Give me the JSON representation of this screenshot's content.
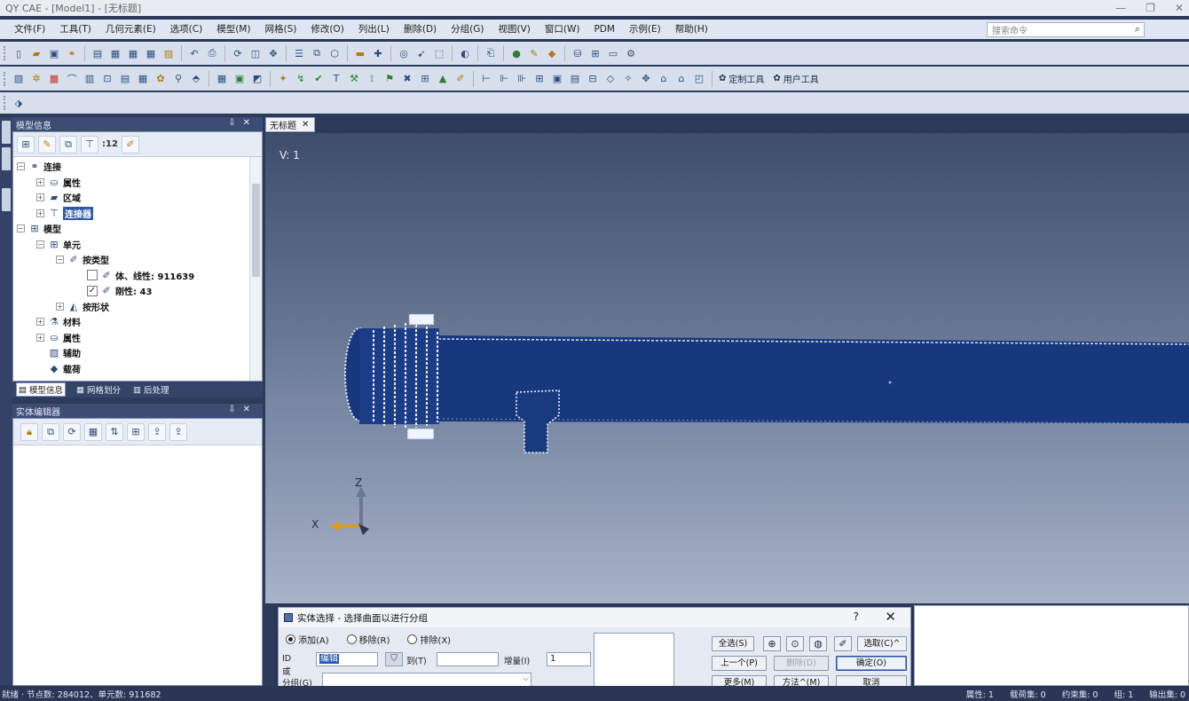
{
  "window": {
    "title": "QY CAE - [Model1] - [无标题]",
    "controls": [
      "—",
      "❐",
      "✕"
    ]
  },
  "menu": [
    "文件(F)",
    "工具(T)",
    "几何元素(E)",
    "选项(C)",
    "模型(M)",
    "网格(S)",
    "修改(O)",
    "列出(L)",
    "删除(D)",
    "分组(G)",
    "视图(V)",
    "窗口(W)",
    "PDM",
    "示例(E)",
    "帮助(H)"
  ],
  "search": {
    "placeholder": "搜索命令",
    "icon": "search-icon"
  },
  "toolbar": {
    "custom_tools": "定制工具",
    "user_tools": "用户工具"
  },
  "model_panel": {
    "title": "模型信息",
    "count_label": ":12",
    "tree": [
      {
        "label": "连接",
        "level": 0,
        "expander": "⊟",
        "icon": "link-icon"
      },
      {
        "label": "属性",
        "level": 1,
        "expander": "⊞",
        "icon": "property-icon"
      },
      {
        "label": "区域",
        "level": 1,
        "expander": "⊞",
        "icon": "region-icon"
      },
      {
        "label": "连接器",
        "level": 1,
        "expander": "⊞",
        "icon": "connector-icon",
        "selected": true
      },
      {
        "label": "模型",
        "level": 0,
        "expander": "⊟",
        "icon": "model-icon"
      },
      {
        "label": "单元",
        "level": 1,
        "expander": "⊟",
        "icon": "element-icon"
      },
      {
        "label": "按类型",
        "level": 2,
        "expander": "⊟",
        "icon": "type-icon"
      },
      {
        "label": "体、线性: 911639",
        "level": 3,
        "checkbox": false,
        "icon": "solid-icon"
      },
      {
        "label": "刚性: 43",
        "level": 3,
        "checkbox": true,
        "icon": "rigid-icon"
      },
      {
        "label": "按形状",
        "level": 2,
        "expander": "⊞",
        "icon": "shape-icon"
      },
      {
        "label": "材料",
        "level": 1,
        "expander": "⊞",
        "icon": "material-icon"
      },
      {
        "label": "属性",
        "level": 1,
        "expander": "⊞",
        "icon": "property-icon"
      },
      {
        "label": "辅助",
        "level": 1,
        "expander": "",
        "icon": "aux-icon"
      },
      {
        "label": "载荷",
        "level": 1,
        "expander": "",
        "icon": "load-icon"
      }
    ],
    "tabs": [
      "模型信息",
      "网格划分",
      "后处理"
    ]
  },
  "entity_editor": {
    "title": "实体编辑器"
  },
  "document_tab": {
    "label": "无标题"
  },
  "viewport": {
    "view_label": "V: 1",
    "axis_z": "Z",
    "axis_x": "X"
  },
  "dialog": {
    "title": "实体选择 - 选择曲面以进行分组",
    "help": "?",
    "close": "✕",
    "radios": [
      {
        "label": "添加(A)",
        "checked": true
      },
      {
        "label": "移除(R)",
        "checked": false
      },
      {
        "label": "排除(X)",
        "checked": false
      }
    ],
    "id_label": "ID",
    "or_label": "或",
    "group_label": "分组(G)",
    "id_value": "编辑",
    "to_label": "到(T)",
    "to_value": "",
    "increment_label": "增量(I)",
    "increment_value": "1",
    "buttons": {
      "select_all": "全选(S)",
      "pick": "选取(C)^",
      "previous": "上一个(P)",
      "remove": "删除(D)",
      "ok": "确定(O)",
      "more": "更多(M)",
      "method": "方法^(M)",
      "cancel": "取消"
    }
  },
  "status": {
    "left": "就绪 · 节点数: 284012、单元数: 911682",
    "right": [
      "属性: 1",
      "载荷集: 0",
      "约束集: 0",
      "组: 1",
      "输出集: 0"
    ]
  }
}
